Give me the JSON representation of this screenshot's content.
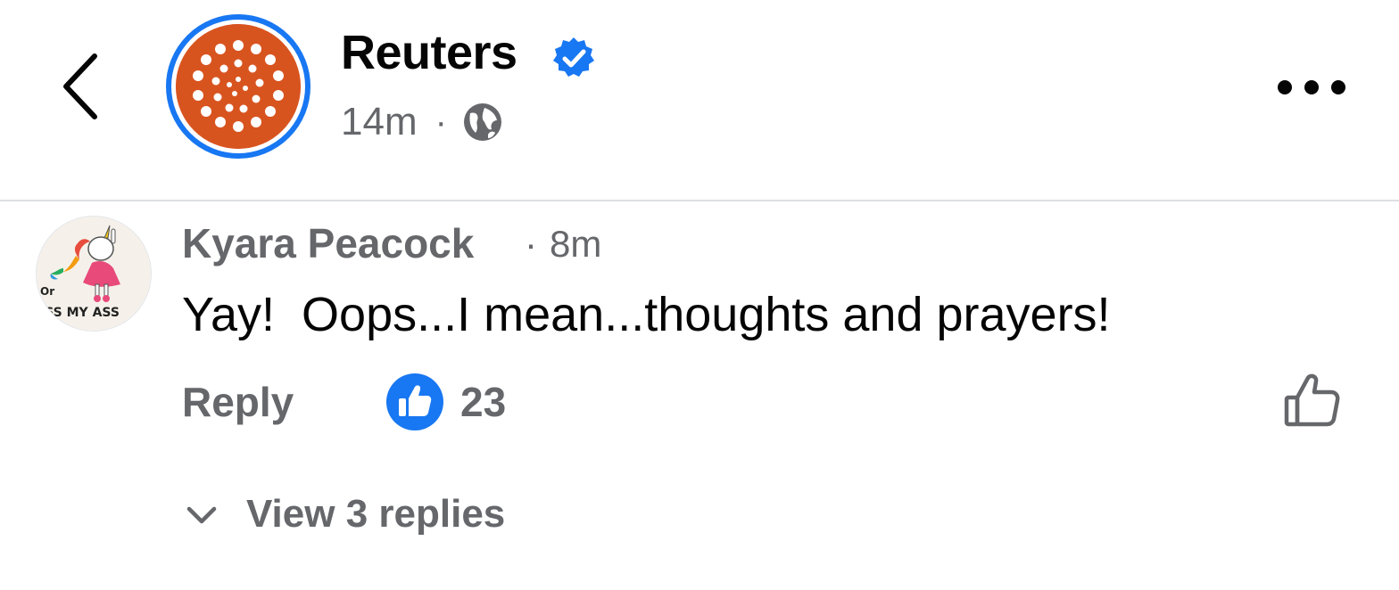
{
  "post_header": {
    "page_name": "Reuters",
    "time_ago": "14m",
    "separator": "·",
    "audience_icon": "globe-icon",
    "verified_icon": "verified-badge-icon",
    "more_icon": "more-options-icon",
    "back_icon": "back-chevron-icon",
    "brand_color": "#d8541f",
    "ring_color": "#1877f2"
  },
  "comment": {
    "author": "Kyara Peacock",
    "separator": "·",
    "time_ago": "8m",
    "text": "Yay!  Oops...I mean...thoughts and prayers!",
    "reply_label": "Reply",
    "like_count": "23",
    "like_badge_icon": "like-reaction-icon",
    "like_button_icon": "thumbs-up-outline-icon",
    "avatar_text_lines": [
      "Or",
      "ISS MY ASS"
    ]
  },
  "replies": {
    "label": "View 3 replies",
    "icon": "chevron-down-icon"
  }
}
